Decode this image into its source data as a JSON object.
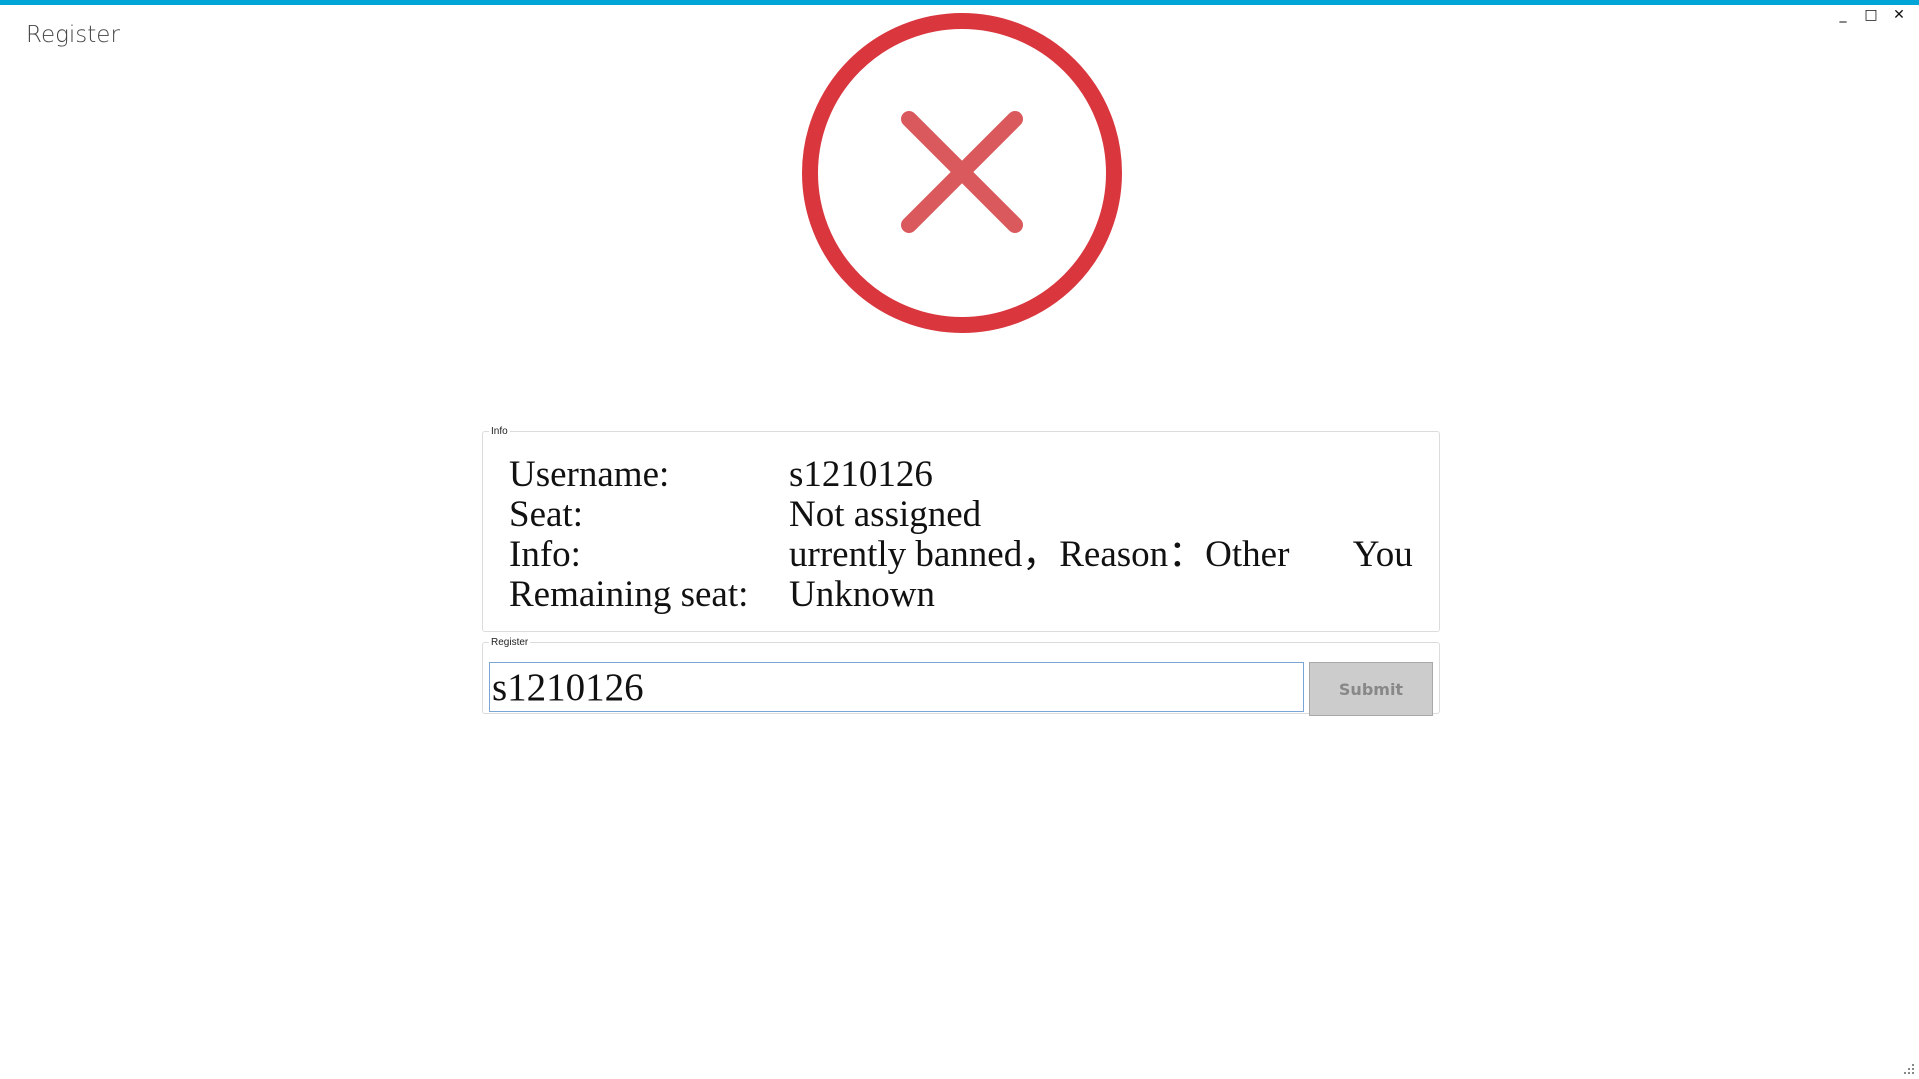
{
  "window": {
    "title": "Register",
    "accent_color": "#00a5d8",
    "controls": {
      "minimize": "_",
      "maximize": "□",
      "close": "✕"
    }
  },
  "status": {
    "icon": "error-circle-x-icon",
    "color": "#d9363e"
  },
  "info": {
    "legend": "Info",
    "rows": [
      {
        "label": "Username:",
        "value": "s1210126"
      },
      {
        "label": "Seat:",
        "value": "Not assigned"
      },
      {
        "label": "Info:",
        "value": "urrently banned，Reason：Other       You are"
      },
      {
        "label": "Remaining seat:",
        "value": "Unknown"
      }
    ]
  },
  "register": {
    "legend": "Register",
    "input_value": "s1210126",
    "submit_label": "Submit"
  }
}
